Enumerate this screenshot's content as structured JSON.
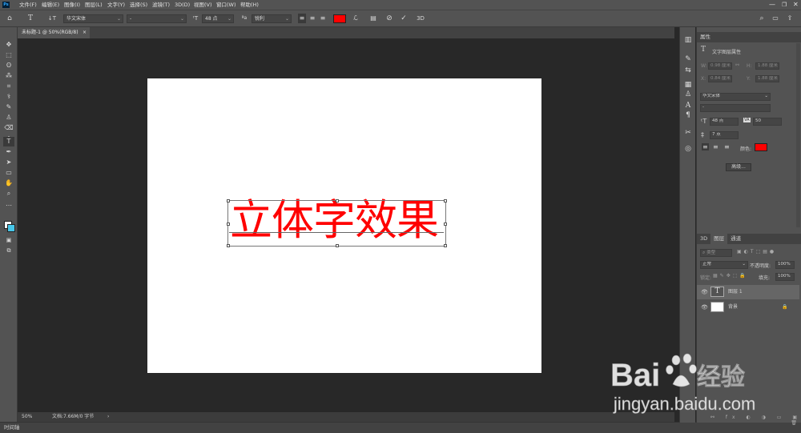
{
  "app": {
    "logo": "Ps"
  },
  "menu": [
    "文件(F)",
    "编辑(E)",
    "图像(I)",
    "图层(L)",
    "文字(Y)",
    "选择(S)",
    "滤镜(T)",
    "3D(D)",
    "视图(V)",
    "窗口(W)",
    "帮助(H)"
  ],
  "options": {
    "font_family": "华文宋体",
    "font_style": "-",
    "font_size": "48 点",
    "aa": "锐利",
    "text_color": "#ff0000",
    "commit_3d": "3D"
  },
  "document": {
    "tab_title": "未标题-1 @ 50%(RGB/8)",
    "tab_close": "×",
    "text": "立体字效果",
    "canvas_bg": "#ffffff"
  },
  "status": {
    "zoom": "50%",
    "doc_info": "文档:7.66M/0 字节",
    "arrow": "›"
  },
  "timeline": {
    "label": "时间轴"
  },
  "properties": {
    "tab": "属性",
    "layer_kind": "文字图层属性",
    "w_label": "W:",
    "w_value": "0.98 厘米",
    "h_label": "H:",
    "h_value": "1.88 厘米",
    "x_label": "X:",
    "x_value": "0.84 厘米",
    "y_label": "Y:",
    "y_value": "1.88 厘米",
    "font_family": "华文宋体",
    "font_style": "-",
    "font_size": "48 点",
    "tracking_label": "VA",
    "tracking": "50",
    "leading": "7 点",
    "color_label": "颜色:",
    "color": "#ff0000",
    "advanced": "高级..."
  },
  "layers_panel": {
    "tabs": [
      "3D",
      "图层",
      "通道"
    ],
    "search": "类型",
    "blend": "正常",
    "opacity_label": "不透明度:",
    "opacity": "100%",
    "lock_label": "锁定:",
    "fill_label": "填充:",
    "fill": "100%",
    "layers": [
      {
        "name": "图层 1",
        "type": "text"
      },
      {
        "name": "背景",
        "type": "background"
      }
    ]
  },
  "watermark": {
    "brand": "Bai",
    "brand2": "经验",
    "url": "jingyan.baidu.com"
  }
}
